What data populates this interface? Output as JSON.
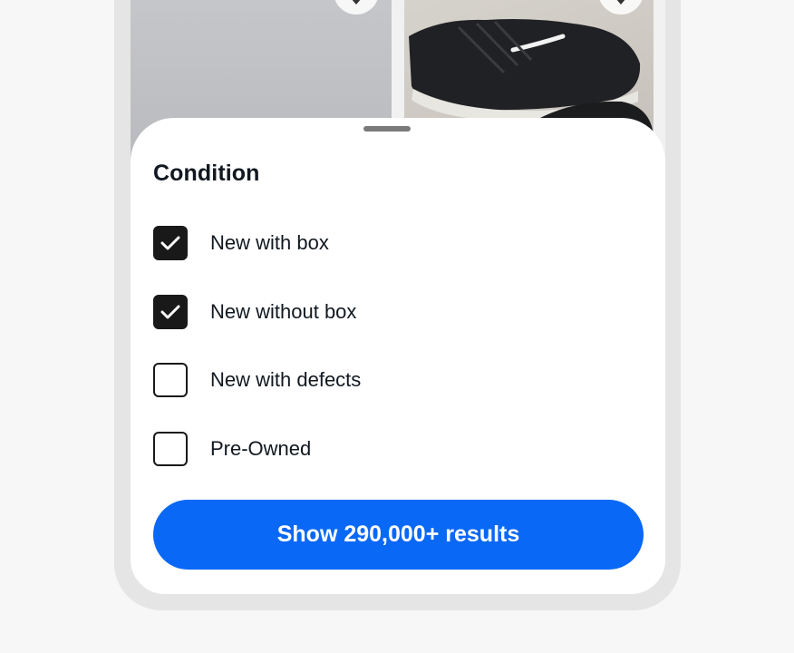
{
  "listing": {
    "items": [
      {
        "image": "product-photo-gray",
        "wishlist_icon": "heart-icon"
      },
      {
        "image": "black-running-shoes",
        "wishlist_icon": "heart-icon"
      }
    ]
  },
  "sheet": {
    "handle_icon": "drag-handle",
    "title": "Condition",
    "options": [
      {
        "label": "New with box",
        "checked": true
      },
      {
        "label": "New without box",
        "checked": true
      },
      {
        "label": "New with defects",
        "checked": false
      },
      {
        "label": "Pre-Owned",
        "checked": false
      }
    ],
    "submit_label": "Show 290,000+ results"
  },
  "colors": {
    "accent": "#0968f6",
    "checkbox": "#191919",
    "text": "#111820",
    "frame": "#e5e5e5",
    "page_bg": "#f7f7f7"
  }
}
